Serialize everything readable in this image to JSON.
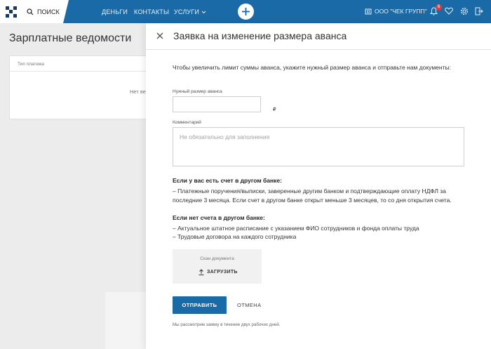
{
  "nav": {
    "search_label": "ПОИСК",
    "links": [
      "ДЕНЬГИ",
      "КОНТАКТЫ",
      "УСЛУГИ"
    ],
    "company": "ООО \"ЧЕК ГРУПП\"",
    "notifications_count": "6",
    "brand_color": "#1a6aa8"
  },
  "background": {
    "page_title": "Зарплатные ведомости",
    "table_header": "Тип платежа",
    "empty_text": "Нет ве"
  },
  "drawer": {
    "title": "Заявка на изменение размера аванса",
    "intro": "Чтобы увеличить лимит суммы аванса, укажите нужный размер аванса и отправьте нам документы:",
    "amount_label": "Нужный размер аванса",
    "amount_value": "",
    "currency": "₽",
    "comment_label": "Комментарий",
    "comment_placeholder": "Не обязательно для заполнения",
    "other_bank_heading": "Если у вас есть счет в другом банке:",
    "other_bank_text": "– Платежные поручения/выписки, заверенные другим банком и подтверждающие оплату НДФЛ за последние 3 месяца. Если счет в другом банке открыт меньше 3 месяцев, то со дня открытия счета.",
    "no_account_heading": "Если нет счета в другом банке:",
    "no_account_line1": "– Актуальное штатное расписание с указанием ФИО сотрудников и фонда оплаты труда",
    "no_account_line2": "– Трудовые договора на каждого сотрудника",
    "upload_label": "Скан документа",
    "upload_button": "ЗАГРУЗИТЬ",
    "submit_button": "ОТПРАВИТЬ",
    "cancel_button": "ОТМЕНА",
    "footnote": "Мы рассмотрим заявку в течение двух рабочих дней."
  }
}
